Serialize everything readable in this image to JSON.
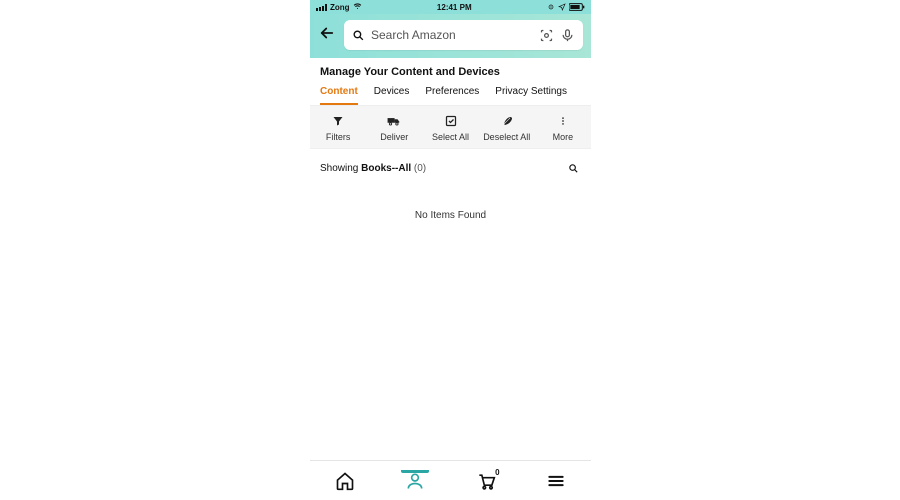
{
  "status": {
    "carrier": "Zong",
    "time": "12:41 PM"
  },
  "search": {
    "placeholder": "Search Amazon"
  },
  "page": {
    "title": "Manage Your Content and Devices"
  },
  "tabs": {
    "content": "Content",
    "devices": "Devices",
    "preferences": "Preferences",
    "privacy": "Privacy Settings"
  },
  "toolbar": {
    "filters": "Filters",
    "deliver": "Deliver",
    "select_all": "Select All",
    "deselect_all": "Deselect All",
    "more": "More"
  },
  "showing": {
    "prefix": "Showing ",
    "category": "Books--All",
    "count_text": " (0)"
  },
  "empty_message": "No Items Found",
  "cart": {
    "count": "0"
  },
  "colors": {
    "accent": "#e47911",
    "teal": "#2aa6a4"
  }
}
